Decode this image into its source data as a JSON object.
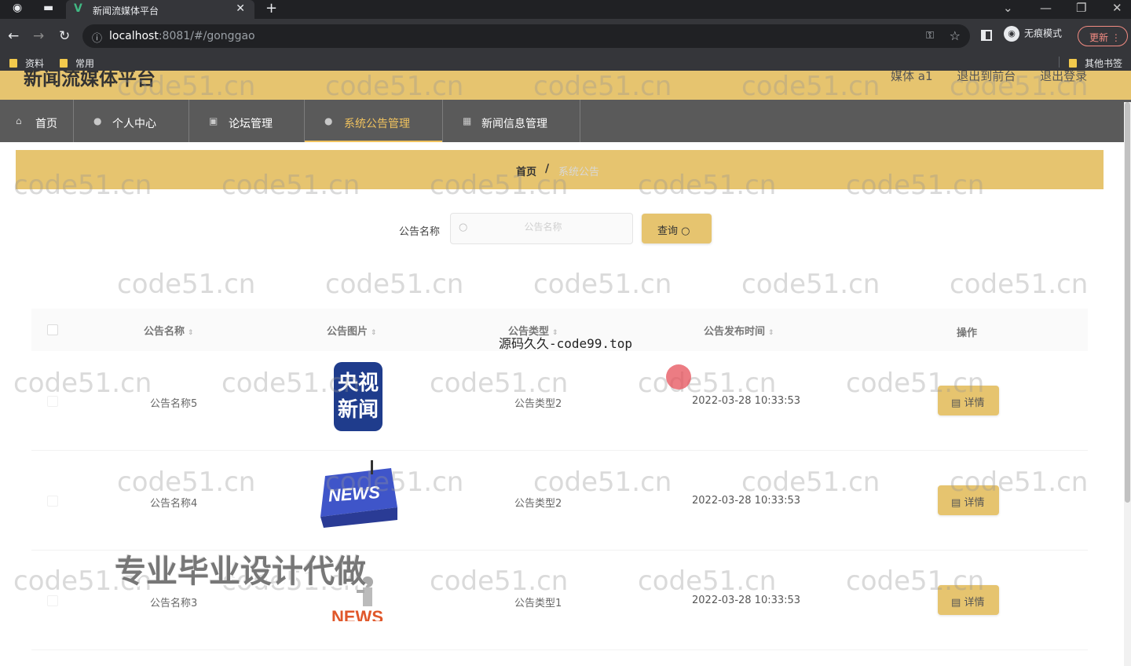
{
  "browser": {
    "tab_title": "新闻流媒体平台",
    "url_host": "localhost",
    "url_rest": ":8081/#/gonggao",
    "incognito_label": "无痕模式",
    "update_label": "更新",
    "bookmarks": [
      "资料",
      "常用"
    ],
    "other_bookmarks": "其他书签"
  },
  "header": {
    "title": "新闻流媒体平台",
    "links": [
      "媒体 a1",
      "退出到前台",
      "退出登录"
    ]
  },
  "nav": {
    "items": [
      {
        "label": "首页",
        "icon": "home-icon"
      },
      {
        "label": "个人中心",
        "icon": "user-icon"
      },
      {
        "label": "论坛管理",
        "icon": "forum-icon"
      },
      {
        "label": "系统公告管理",
        "icon": "bulb-icon",
        "active": true
      },
      {
        "label": "新闻信息管理",
        "icon": "grid-icon"
      }
    ]
  },
  "breadcrumb": {
    "home": "首页",
    "separator": "/",
    "current": "系统公告"
  },
  "search": {
    "label": "公告名称",
    "placeholder": "公告名称",
    "button": "查询"
  },
  "table": {
    "columns": [
      "公告名称",
      "公告图片",
      "公告类型",
      "公告发布时间",
      "操作"
    ],
    "rows": [
      {
        "name": "公告名称5",
        "image": "cctv-news-logo",
        "type": "公告类型2",
        "time": "2022-03-28 10:33:53",
        "action": "详情"
      },
      {
        "name": "公告名称4",
        "image": "news-keyboard",
        "type": "公告类型2",
        "time": "2022-03-28 10:33:53",
        "action": "详情"
      },
      {
        "name": "公告名称3",
        "image": "news-figure",
        "type": "公告类型1",
        "time": "2022-03-28 10:33:53",
        "action": "详情"
      }
    ]
  },
  "thumbnail_text": {
    "cctv": "央视\n新闻",
    "news": "NEWS"
  },
  "overlays": {
    "watermark": "code51.cn",
    "code99": "源码久久-code99.top",
    "promo": "专业毕业设计代做"
  },
  "colors": {
    "accent": "#e6c46f",
    "nav_bg": "#5a5a5a",
    "active": "#f0c25e"
  }
}
